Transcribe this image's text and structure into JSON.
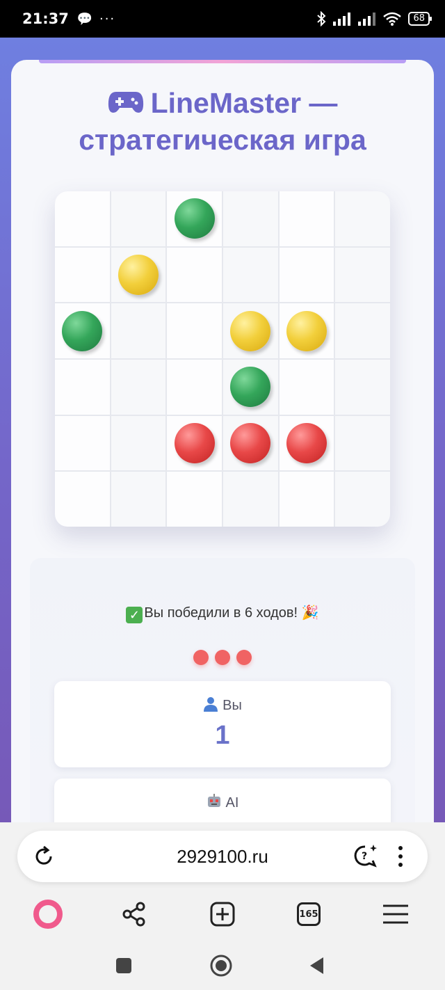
{
  "status_bar": {
    "time": "21:37",
    "left_icons": "💬 ···",
    "battery": "68"
  },
  "app": {
    "title_line1": "LineMaster —",
    "title_line2": "стратегическая игра",
    "board": [
      [
        "",
        "",
        "green",
        "",
        "",
        ""
      ],
      [
        "",
        "yellow",
        "",
        "",
        "",
        ""
      ],
      [
        "green",
        "",
        "",
        "yellow",
        "yellow",
        ""
      ],
      [
        "",
        "",
        "",
        "green",
        "",
        ""
      ],
      [
        "",
        "",
        "red",
        "red",
        "red",
        ""
      ],
      [
        "",
        "",
        "",
        "",
        "",
        ""
      ]
    ],
    "status_message": "Вы победили в 6 ходов! 🎉",
    "player_label": "Вы",
    "player_score": "1",
    "ai_label": "AI"
  },
  "browser": {
    "url": "2929100.ru",
    "tabs_count": "165"
  },
  "colors": {
    "accent": "#6b66c9",
    "dot": "#f06363",
    "alice": "#f05a8c"
  }
}
